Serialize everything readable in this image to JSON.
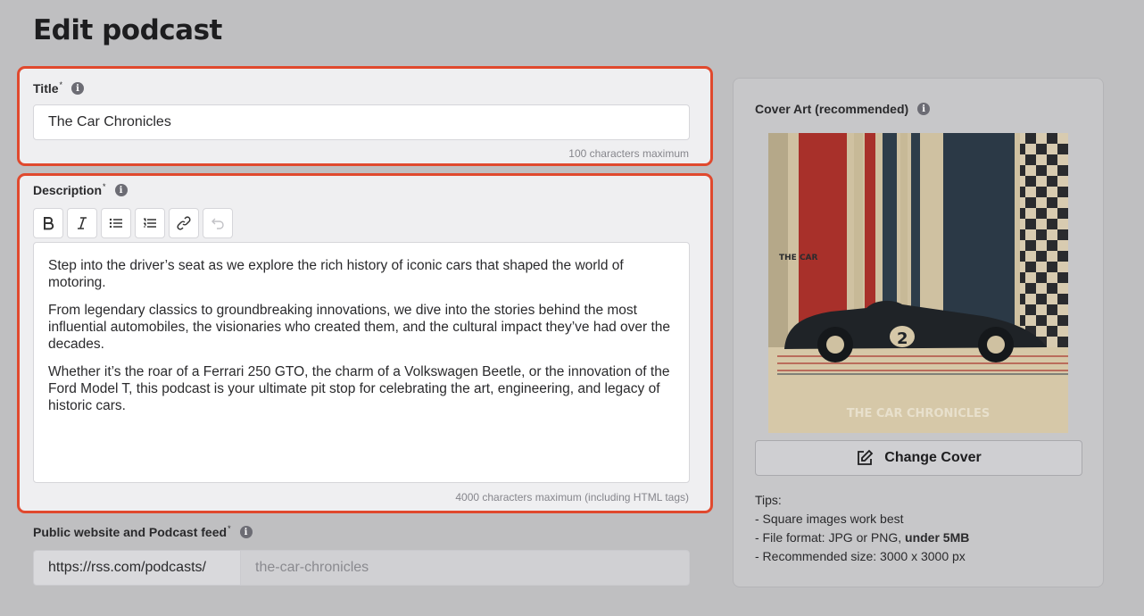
{
  "page": {
    "title": "Edit podcast"
  },
  "title_field": {
    "label": "Title",
    "required_mark": "*",
    "value": "The Car Chronicles",
    "hint": "100 characters maximum"
  },
  "description_field": {
    "label": "Description",
    "required_mark": "*",
    "toolbar": [
      "bold-icon",
      "italic-icon",
      "bullet-list-icon",
      "numbered-list-icon",
      "link-icon",
      "undo-icon"
    ],
    "paragraphs": [
      "Step into the driver’s seat as we explore the rich history of iconic cars that shaped the world of motoring.",
      "From legendary classics to groundbreaking innovations, we dive into the stories behind the most influential automobiles, the visionaries who created them, and the cultural impact they’ve had over the decades.",
      "Whether it’s the roar of a Ferrari 250 GTO, the charm of a Volkswagen Beetle, or the innovation of the Ford Model T, this podcast is your ultimate pit stop for celebrating the art, engineering, and legacy of historic cars."
    ],
    "hint": "4000 characters maximum (including HTML tags)"
  },
  "public_field": {
    "label": "Public website and Podcast feed",
    "required_mark": "*",
    "prefix": "https://rss.com/podcasts/",
    "slug": "the-car-chronicles"
  },
  "cover": {
    "label": "Cover Art (recommended)",
    "art_text_top": "THE CAR",
    "art_text_bottom": "THE CAR CHRONICLES",
    "art_number": "2",
    "change_button": "Change Cover",
    "tips_heading": "Tips:",
    "tip_1": "- Square images work best",
    "tip_2_prefix": "- File format: JPG or PNG, ",
    "tip_2_bold": "under 5MB",
    "tip_3": "- Recommended size: 3000 x 3000 px"
  },
  "colors": {
    "highlight": "#e0492e",
    "background": "#bfbfc1"
  }
}
